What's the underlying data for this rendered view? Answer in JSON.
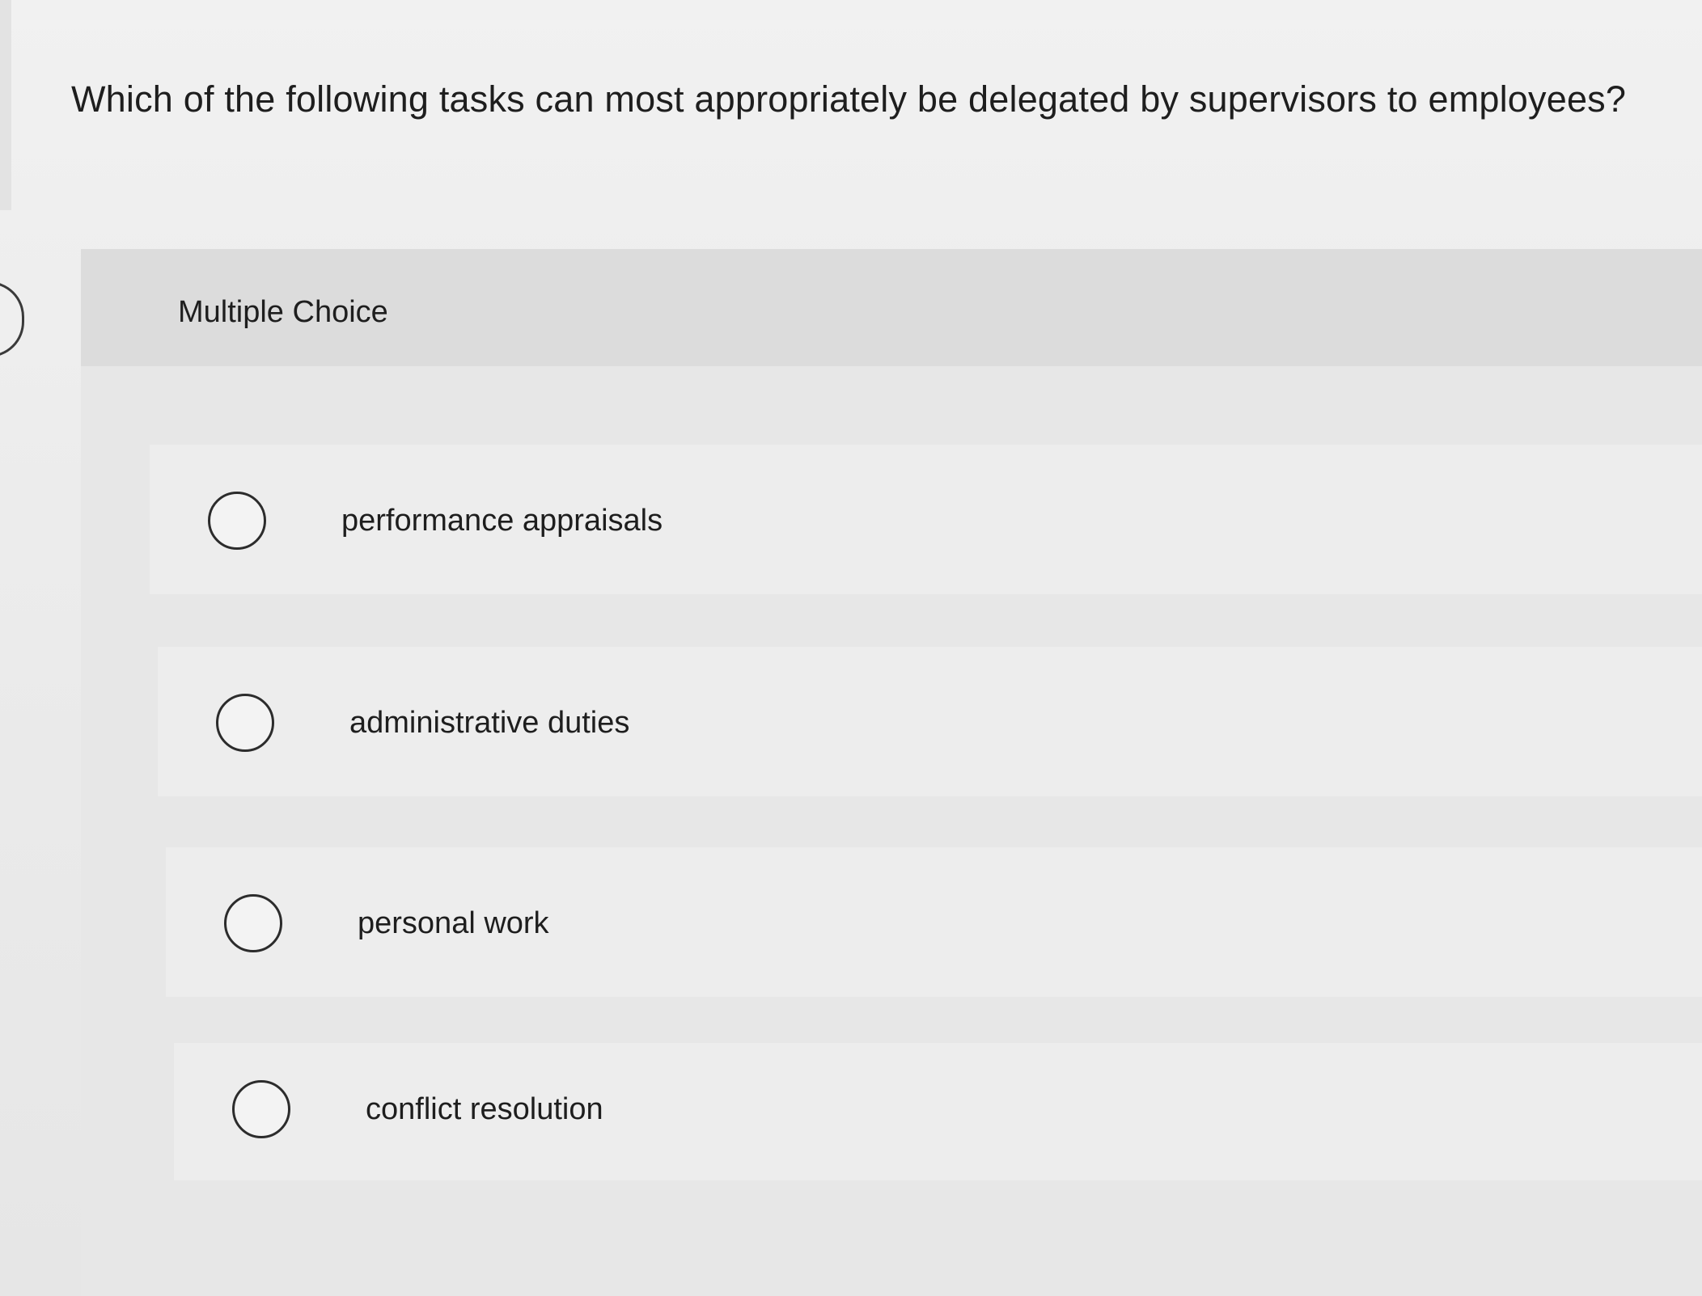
{
  "question": {
    "text": "Which of the following tasks can most appropriately be delegated by supervisors to employees?"
  },
  "answer_card": {
    "type_label": "Multiple Choice",
    "options": [
      {
        "label": "performance appraisals",
        "selected": false
      },
      {
        "label": "administrative duties",
        "selected": false
      },
      {
        "label": "personal work",
        "selected": false
      },
      {
        "label": "conflict resolution",
        "selected": false
      }
    ]
  },
  "colors": {
    "background": "#ececec",
    "card": "#e7e7e7",
    "card_header": "#dcdcdc",
    "option_row": "#ededed",
    "radio_border": "#2c2c2c",
    "text": "#1e1e1e"
  },
  "icons": {
    "radio": "radio-unselected-icon",
    "side_tab": "side-panel-tab-icon"
  }
}
